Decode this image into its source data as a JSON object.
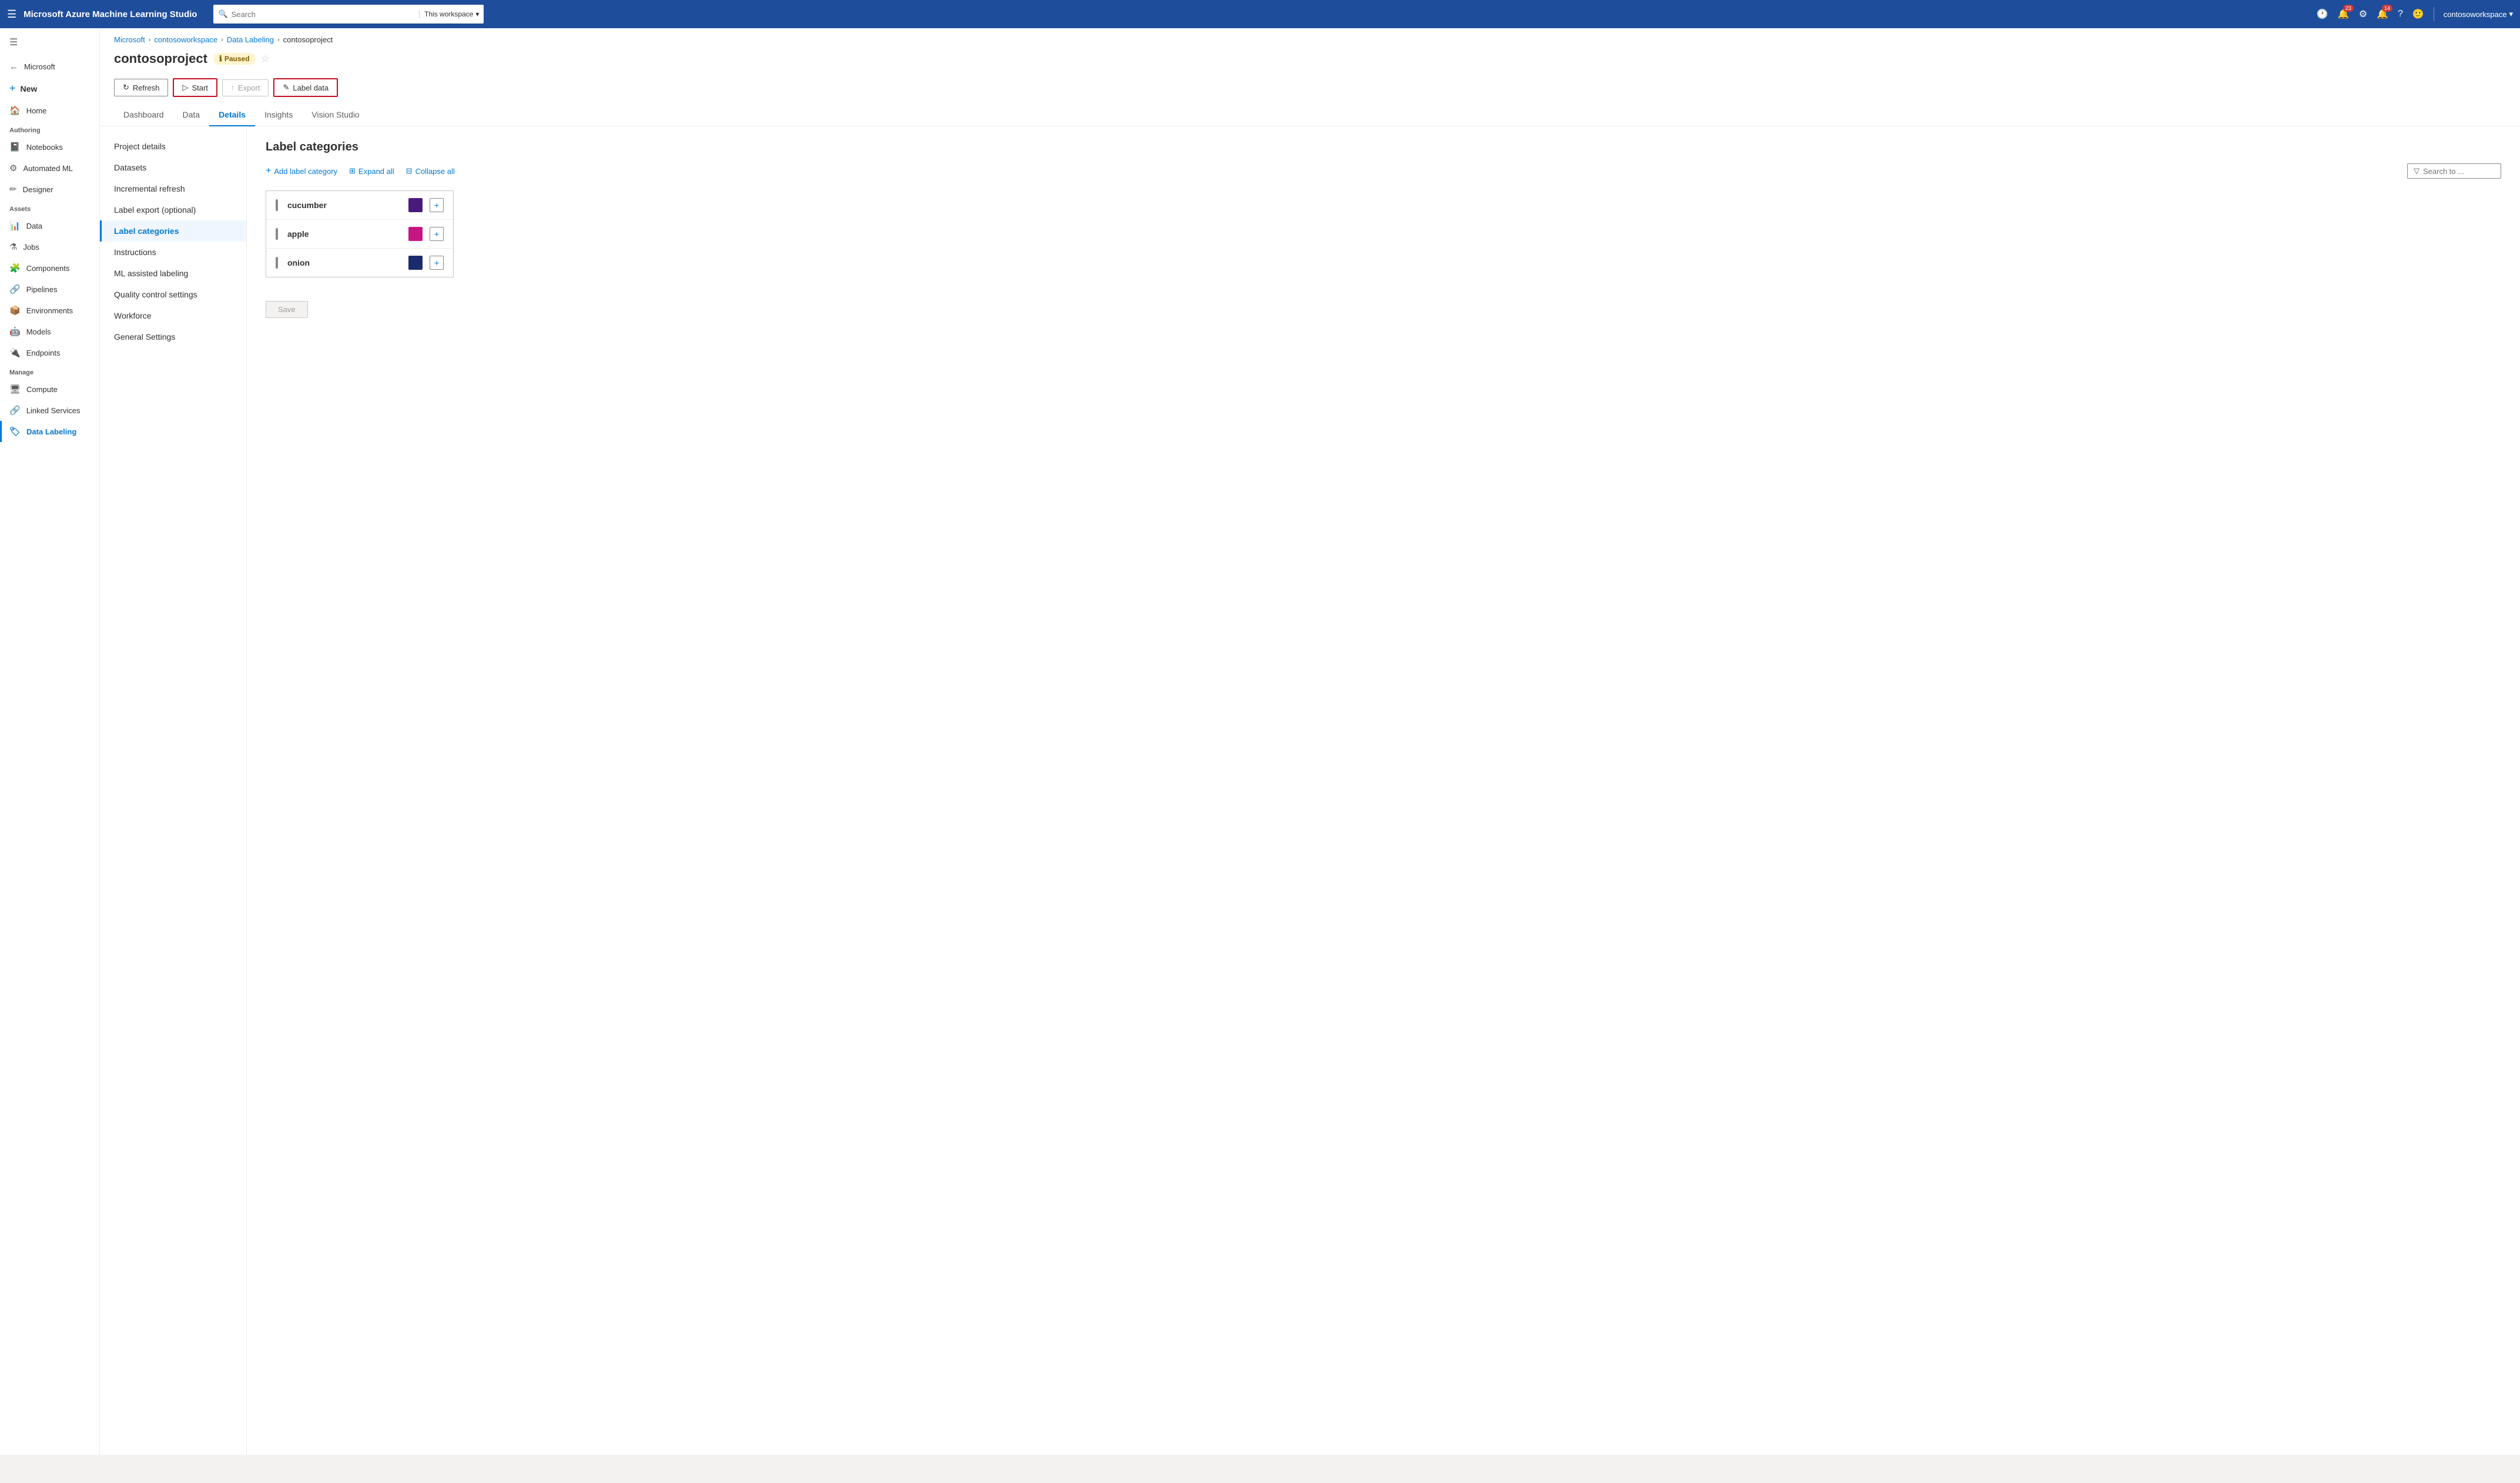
{
  "topbar": {
    "title": "Microsoft Azure Machine Learning Studio",
    "search_placeholder": "Search",
    "search_scope": "This workspace",
    "notifications_count": "23",
    "alerts_count": "14",
    "username": "contosoworkspace"
  },
  "sidebar": {
    "new_label": "New",
    "items": [
      {
        "id": "home",
        "label": "Home",
        "icon": "🏠"
      },
      {
        "id": "notebooks",
        "label": "Notebooks",
        "icon": "📓",
        "section": "Authoring"
      },
      {
        "id": "automated-ml",
        "label": "Automated ML",
        "icon": "⚙"
      },
      {
        "id": "designer",
        "label": "Designer",
        "icon": "🔧"
      },
      {
        "id": "data",
        "label": "Data",
        "icon": "📊",
        "section": "Assets"
      },
      {
        "id": "jobs",
        "label": "Jobs",
        "icon": "💼"
      },
      {
        "id": "components",
        "label": "Components",
        "icon": "🧩"
      },
      {
        "id": "pipelines",
        "label": "Pipelines",
        "icon": "🔗"
      },
      {
        "id": "environments",
        "label": "Environments",
        "icon": "📦"
      },
      {
        "id": "models",
        "label": "Models",
        "icon": "🤖"
      },
      {
        "id": "endpoints",
        "label": "Endpoints",
        "icon": "🔌"
      },
      {
        "id": "compute",
        "label": "Compute",
        "icon": "🖥",
        "section": "Manage"
      },
      {
        "id": "linked-services",
        "label": "Linked Services",
        "icon": "🔗"
      },
      {
        "id": "data-labeling",
        "label": "Data Labeling",
        "icon": "🏷",
        "active": true
      }
    ]
  },
  "breadcrumb": {
    "items": [
      "Microsoft",
      "contosoworkspace",
      "Data Labeling",
      "contosoproject"
    ]
  },
  "page": {
    "title": "contosoproject",
    "status": "Paused",
    "toolbar": {
      "refresh": "Refresh",
      "start": "Start",
      "export": "Export",
      "label_data": "Label data"
    },
    "tabs": [
      "Dashboard",
      "Data",
      "Details",
      "Insights",
      "Vision Studio"
    ],
    "active_tab": "Details"
  },
  "left_nav": {
    "items": [
      "Project details",
      "Datasets",
      "Incremental refresh",
      "Label export (optional)",
      "Label categories",
      "Instructions",
      "ML assisted labeling",
      "Quality control settings",
      "Workforce",
      "General Settings"
    ],
    "active": "Label categories"
  },
  "label_categories": {
    "title": "Label categories",
    "add_label": "Add label category",
    "expand_all": "Expand all",
    "collapse_all": "Collapse all",
    "search_placeholder": "Search to ...",
    "items": [
      {
        "name": "cucumber",
        "color": "#4a1a7a"
      },
      {
        "name": "apple",
        "color": "#c71585"
      },
      {
        "name": "onion",
        "color": "#1a2b6b"
      }
    ]
  },
  "save": {
    "label": "Save"
  }
}
